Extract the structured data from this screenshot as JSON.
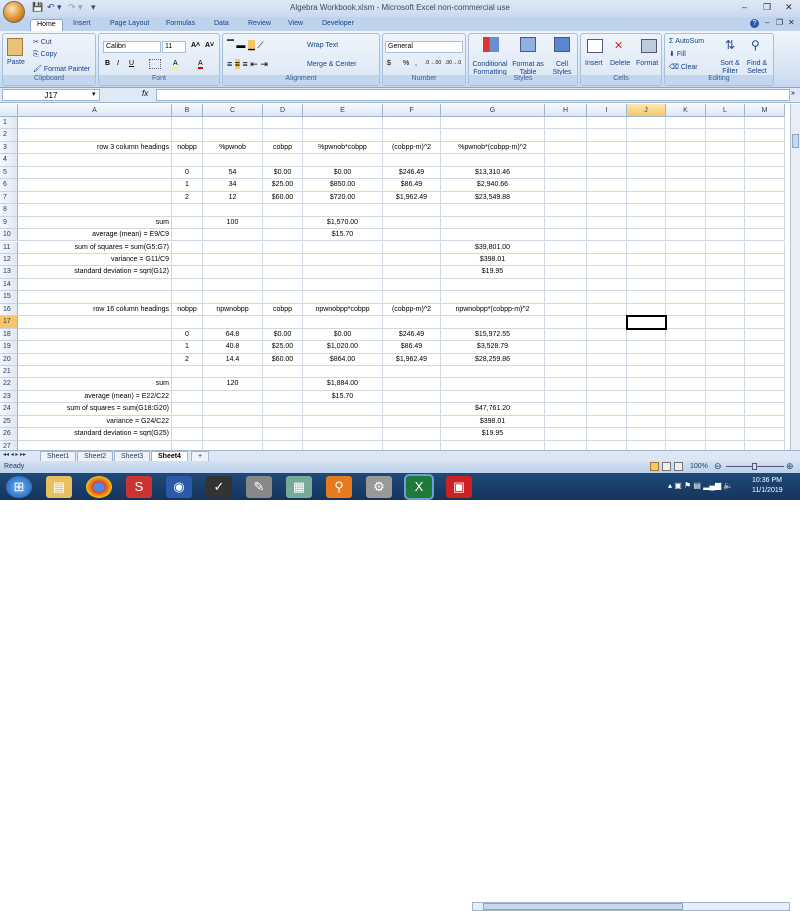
{
  "window": {
    "title": "Algebra Workbook.xlsm - Microsoft Excel non-commercial use",
    "minimize": "–",
    "restore": "❐",
    "close": "✕"
  },
  "qat": {
    "save": "💾",
    "undo": "↶ ▾",
    "redo": "↷ ▾",
    "customize": "▾"
  },
  "tabs": [
    "Home",
    "Insert",
    "Page Layout",
    "Formulas",
    "Data",
    "Review",
    "View",
    "Developer"
  ],
  "help": "?",
  "ribbon": {
    "clipboard": {
      "label": "Clipboard",
      "paste": "Paste",
      "cut": "Cut",
      "copy": "Copy",
      "format_painter": "Format Painter"
    },
    "font": {
      "label": "Font",
      "name": "Calibri",
      "size": "11",
      "bold": "B",
      "italic": "I",
      "underline": "U",
      "grow": "A˄",
      "shrink": "A˅",
      "fill": "A",
      "color": "A"
    },
    "alignment": {
      "label": "Alignment",
      "wrap": "Wrap Text",
      "merge": "Merge & Center"
    },
    "number": {
      "label": "Number",
      "format": "General",
      "currency": "$",
      "percent": "%",
      "comma": ",",
      "inc": ".0→.00",
      "dec": ".00→.0"
    },
    "styles": {
      "label": "Styles",
      "conditional": "Conditional Formatting",
      "table": "Format as Table",
      "cell": "Cell Styles"
    },
    "cells": {
      "label": "Cells",
      "insert": "Insert",
      "delete": "Delete",
      "format": "Format"
    },
    "editing": {
      "label": "Editing",
      "autosum": "AutoSum",
      "fill": "Fill",
      "clear": "Clear",
      "sort": "Sort & Filter",
      "find": "Find & Select"
    }
  },
  "formula_bar": {
    "name_box": "J17",
    "fx": "fx",
    "value": ""
  },
  "columns": [
    "A",
    "B",
    "C",
    "D",
    "E",
    "F",
    "G",
    "H",
    "I",
    "J",
    "K",
    "L",
    "M"
  ],
  "selected_cell": "J17",
  "rows": [
    {},
    {},
    {
      "A": "row 3 column headings",
      "B": "nobpp",
      "C": "%pwnob",
      "D": "cobpp",
      "E": "%pwnob*cobpp",
      "F": "(cobpp-m)^2",
      "G": "%pwnob*(cobpp-m)^2"
    },
    {},
    {
      "B": "0",
      "C": "54",
      "D": "$0.00",
      "E": "$0.00",
      "F": "$246.49",
      "G": "$13,310.46"
    },
    {
      "B": "1",
      "C": "34",
      "D": "$25.00",
      "E": "$850.00",
      "F": "$86.49",
      "G": "$2,940.66"
    },
    {
      "B": "2",
      "C": "12",
      "D": "$60.00",
      "E": "$720.00",
      "F": "$1,962.49",
      "G": "$23,549.88"
    },
    {},
    {
      "A": "sum",
      "C": "100",
      "E": "$1,570.00"
    },
    {
      "A": "average (mean) = E9/C9",
      "E": "$15.70"
    },
    {
      "A": "sum of squares = sum(G5:G7)",
      "G": "$39,801.00"
    },
    {
      "A": "variance = G11/C9",
      "G": "$398.01"
    },
    {
      "A": "standard deviation = sqrt(G12)",
      "G": "$19.95"
    },
    {},
    {},
    {
      "A": "row 16 column headings",
      "B": "nobpp",
      "C": "npwnobpp",
      "D": "cobpp",
      "E": "npwnobpp*cobpp",
      "F": "(cobpp-m)^2",
      "G": "npwnobpp*(cobpp-m)^2"
    },
    {},
    {
      "B": "0",
      "C": "64.8",
      "D": "$0.00",
      "E": "$0.00",
      "F": "$246.49",
      "G": "$15,972.55"
    },
    {
      "B": "1",
      "C": "40.8",
      "D": "$25.00",
      "E": "$1,020.00",
      "F": "$86.49",
      "G": "$3,528.79"
    },
    {
      "B": "2",
      "C": "14.4",
      "D": "$60.00",
      "E": "$864.00",
      "F": "$1,962.49",
      "G": "$28,259.86"
    },
    {},
    {
      "A": "sum",
      "C": "120",
      "E": "$1,884.00"
    },
    {
      "A": "average (mean) = E22/C22",
      "E": "$15.70"
    },
    {
      "A": "sum of squares = sum(G18:G20)",
      "G": "$47,761.20"
    },
    {
      "A": "variance = G24/C22",
      "G": "$398.01"
    },
    {
      "A": "standard deviation = sqrt(G25)",
      "G": "$19.95"
    },
    {}
  ],
  "sheets": [
    "Sheet1",
    "Sheet2",
    "Sheet3",
    "Sheet4"
  ],
  "active_sheet": "Sheet4",
  "status": {
    "text": "Ready",
    "zoom": "100%"
  },
  "taskbar": {
    "time": "10:36 PM",
    "date": "11/1/2019",
    "apps": [
      "start",
      "explorer",
      "chrome",
      "app-s",
      "app-circle",
      "app-v",
      "app-tool",
      "app-scanner",
      "search",
      "app-gear",
      "excel",
      "app-red"
    ]
  }
}
